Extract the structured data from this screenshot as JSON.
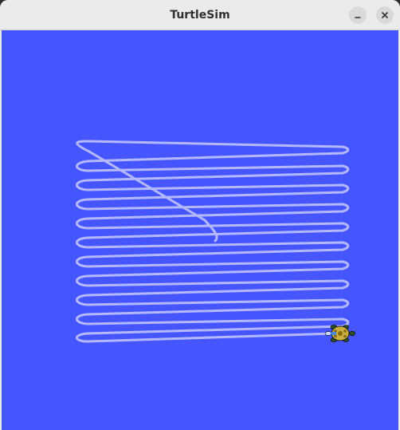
{
  "window": {
    "title": "TurtleSim",
    "minimize_icon": "minimize-icon",
    "close_icon": "close-icon"
  },
  "canvas": {
    "background_color": "#4556ff",
    "pen_color": "#b3b8ff",
    "turtle_icon": "turtle-icon"
  }
}
